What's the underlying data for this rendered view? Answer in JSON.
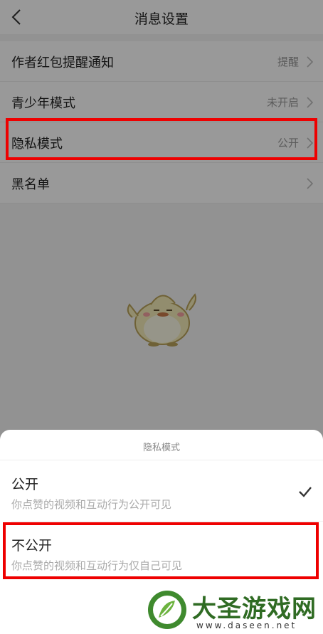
{
  "header": {
    "title": "消息设置"
  },
  "settings": [
    {
      "label": "作者红包提醒通知",
      "value": "提醒"
    },
    {
      "label": "青少年模式",
      "value": "未开启"
    },
    {
      "label": "隐私模式",
      "value": "公开"
    },
    {
      "label": "黑名单",
      "value": ""
    }
  ],
  "sheet": {
    "title": "隐私模式",
    "options": [
      {
        "title": "公开",
        "desc": "你点赞的视频和互动行为公开可见",
        "selected": true
      },
      {
        "title": "不公开",
        "desc": "你点赞的视频和互动行为仅自己可见",
        "selected": false
      }
    ]
  },
  "watermark": {
    "name": "大圣游戏网",
    "url": "www.daseen.net"
  },
  "colors": {
    "highlight": "#ee0000",
    "watermark_text": "#2f6b23"
  }
}
